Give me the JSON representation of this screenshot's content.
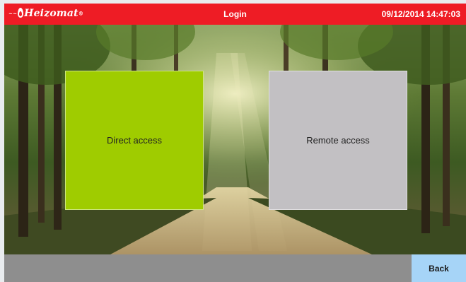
{
  "header": {
    "logo_text": "Heizomat",
    "title": "Login",
    "datetime": "09/12/2014 14:47:03"
  },
  "main": {
    "direct_access_label": "Direct access",
    "remote_access_label": "Remote access"
  },
  "footer": {
    "back_label": "Back"
  },
  "colors": {
    "titlebar": "#ee1c25",
    "direct_access": "#9fcc00",
    "remote_access": "#c2c0c3",
    "back_button": "#a6d4f7",
    "footer": "#8e8e8e"
  }
}
